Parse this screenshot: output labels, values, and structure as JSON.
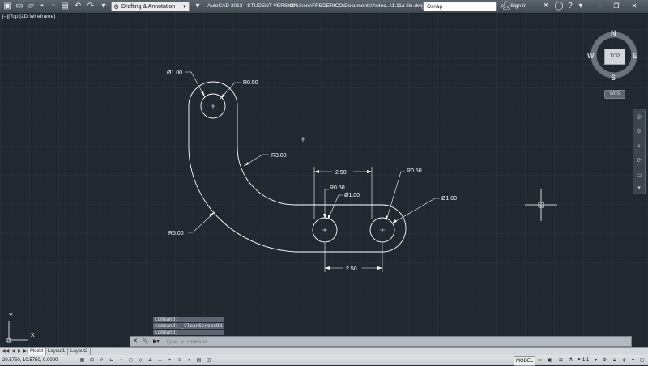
{
  "titlebar": {
    "workspace": "Drafting & Annotation",
    "app_title": "AutoCAD 2013 - STUDENT VERSION",
    "file_path": "C:\\Users\\FREDERICO\\Documents\\Autoc...\\1.11a file.dwg",
    "search_placeholder": "Osnap",
    "sign_in": "Sign In",
    "minimize": "–",
    "restore": "❐",
    "close": "✕"
  },
  "viewport": {
    "label": "[–][Top][2D Wireframe]"
  },
  "drawing": {
    "dims": {
      "dia_top": "Ø1.00",
      "r_top": "R0.50",
      "r_inner": "R3.00",
      "r_outer": "R5.00",
      "top_span": "2.50",
      "r_right": "R0.50",
      "r_mid": "R0.50",
      "dia_mid": "Ø1.00",
      "dia_right": "Ø1.00",
      "bottom_span": "2.50"
    }
  },
  "viewcube": {
    "north": "N",
    "south": "S",
    "east": "E",
    "west": "W",
    "top": "TOP",
    "wcs": "WCS"
  },
  "ucs": {
    "x": "X",
    "y": "Y"
  },
  "command": {
    "history": [
      "Command:",
      "Command:  _CleanScreenON",
      "Command:"
    ],
    "placeholder": "Type a command"
  },
  "tabs": {
    "items": [
      "Model",
      "Layout1",
      "Layout2"
    ]
  },
  "status": {
    "coords": "29.5750, 10.5750, 0.0000",
    "model": "MODEL",
    "scale": "1:1"
  },
  "colors": {
    "canvas": "#212830",
    "drawing_line": "#ffffff",
    "grid_major": "#2f3740"
  }
}
